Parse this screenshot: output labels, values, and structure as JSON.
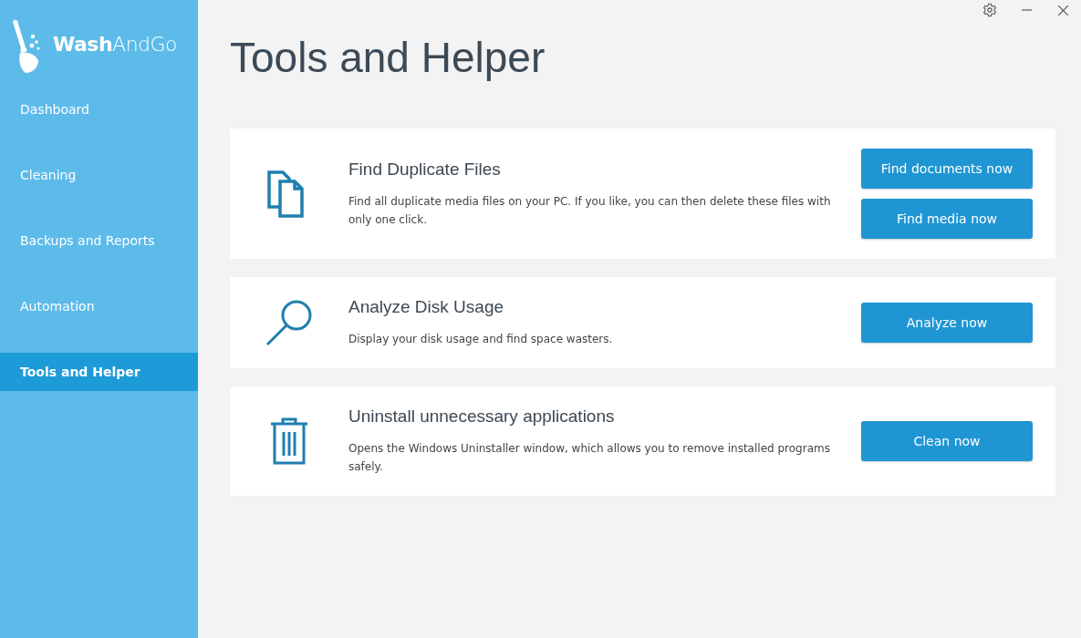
{
  "logo": {
    "text": "**Wash**AndGo"
  },
  "sidebar": {
    "items": [
      {
        "label": "Dashboard",
        "selected": false
      },
      {
        "label": "Cleaning",
        "selected": false
      },
      {
        "label": "Backups and Reports",
        "selected": false
      },
      {
        "label": "Automation",
        "selected": false
      },
      {
        "label": "Tools and Helper",
        "selected": true
      }
    ]
  },
  "page_title": "Tools and Helper",
  "cards": [
    {
      "kind": "files",
      "title": "Find Duplicate Files",
      "description": "Find all duplicate media files on your PC. If you like, you can then delete these files with only one click.",
      "buttons": [
        "Find documents now",
        "Find media now"
      ]
    },
    {
      "kind": "search",
      "title": "Analyze Disk Usage",
      "description": "Display your disk usage and find space wasters.",
      "buttons": [
        "Analyze now"
      ]
    },
    {
      "kind": "trash",
      "title": "Uninstall unnecessary applications",
      "description": "Opens the Windows Uninstaller window, which allows you to remove installed programs safely.",
      "buttons": [
        "Clean now"
      ]
    }
  ]
}
